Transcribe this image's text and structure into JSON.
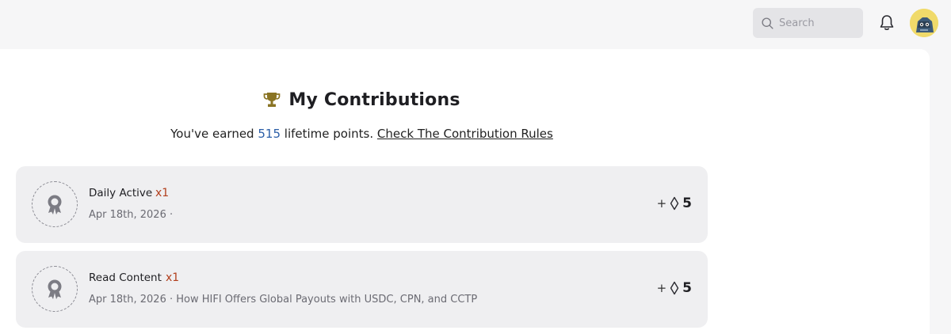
{
  "header": {
    "search": {
      "placeholder": "Search",
      "icon": "search-icon"
    },
    "notifications": {
      "icon": "bell-icon"
    },
    "avatar": {
      "background": "#f0da6a"
    }
  },
  "page": {
    "title": "My Contributions",
    "title_icon": "trophy-icon",
    "subtitle_prefix": "You've earned",
    "lifetime_points": "515",
    "subtitle_suffix": "lifetime points.",
    "rules_link": "Check The Contribution Rules"
  },
  "contributions": [
    {
      "name": "Daily Active",
      "multiplier": "x1",
      "meta": "Apr 18th, 2026 ·",
      "plus": "+",
      "points": "5"
    },
    {
      "name": "Read Content",
      "multiplier": "x1",
      "meta": "Apr 18th, 2026 · How HIFI Offers Global Payouts with USDC, CPN, and CCTP",
      "plus": "+",
      "points": "5"
    }
  ],
  "colors": {
    "accent_points": "#2b5ea7",
    "multiplier": "#b2401e",
    "trophy": "#8a7424"
  }
}
